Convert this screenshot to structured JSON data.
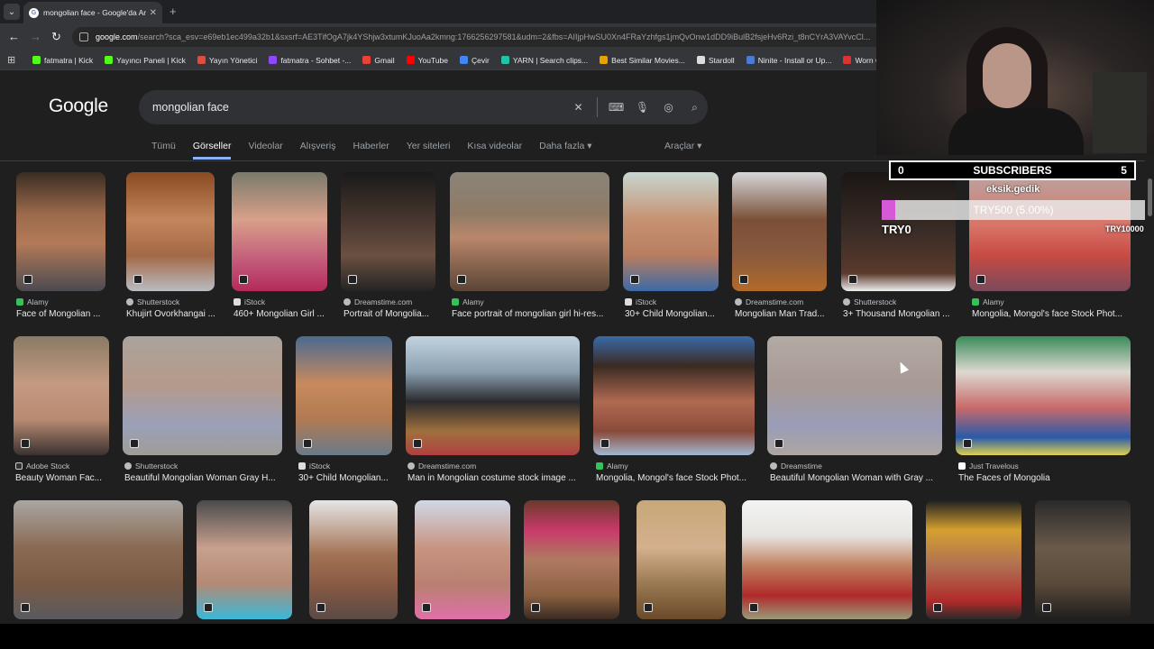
{
  "browser": {
    "tab_title": "mongolian face - Google'da Ara",
    "url_host": "google.com",
    "url_rest": "/search?sca_esv=e69eb1ec499a32b1&sxsrf=AE3TifOgA7jk4YShjw3xtumKJuoAa2kmng:1766256297581&udm=2&fbs=AIIjpHwSU0Xn4FRaYzhfgs1jmQvOnw1dDD9iBulB2fsjeHv6Rzi_t8nCYrA3VAYvcCl...",
    "bookmarks": [
      {
        "label": "fatmatra | Kick",
        "color": "#53fc18"
      },
      {
        "label": "Yayıncı Paneli | Kick",
        "color": "#53fc18"
      },
      {
        "label": "Yayın Yönetici",
        "color": "#e34b3a"
      },
      {
        "label": "fatmatra - Sohbet -...",
        "color": "#9146ff"
      },
      {
        "label": "Gmail",
        "color": "#ea4335"
      },
      {
        "label": "YouTube",
        "color": "#ff0000"
      },
      {
        "label": "Çevir",
        "color": "#4285f4"
      },
      {
        "label": "YARN | Search clips...",
        "color": "#22c3a6"
      },
      {
        "label": "Best Similar Movies...",
        "color": "#e8a100"
      },
      {
        "label": "Stardoll",
        "color": "#dddddd"
      },
      {
        "label": "Ninite - Install or Up...",
        "color": "#4a7bd6"
      },
      {
        "label": "Worn On TV | Wher",
        "color": "#d33"
      }
    ]
  },
  "google": {
    "logo": "Google",
    "query": "mongolian face",
    "tabs": [
      "Tümü",
      "Görseller",
      "Videolar",
      "Alışveriş",
      "Haberler",
      "Yer siteleri",
      "Kısa videolar",
      "Daha fazla ▾"
    ],
    "tools": "Araçlar ▾"
  },
  "results_row1": [
    {
      "source": "Alamy",
      "title": "Face of Mongolian ..."
    },
    {
      "source": "Shutterstock",
      "title": "Khujirt Ovorkhangai ..."
    },
    {
      "source": "iStock",
      "title": "460+ Mongolian Girl ..."
    },
    {
      "source": "Dreamstime.com",
      "title": "Portrait of Mongolia..."
    },
    {
      "source": "Alamy",
      "title": "Face portrait of mongolian girl hi-res..."
    },
    {
      "source": "iStock",
      "title": "30+ Child Mongolian..."
    },
    {
      "source": "Dreamstime.com",
      "title": "Mongolian Man Trad..."
    },
    {
      "source": "Shutterstock",
      "title": "3+ Thousand Mongolian ..."
    },
    {
      "source": "Alamy",
      "title": "Mongolia, Mongol's face Stock Phot..."
    }
  ],
  "results_row2": [
    {
      "source": "Adobe Stock",
      "title": "Beauty Woman Fac..."
    },
    {
      "source": "Shutterstock",
      "title": "Beautiful Mongolian Woman Gray H..."
    },
    {
      "source": "iStock",
      "title": "30+ Child Mongolian..."
    },
    {
      "source": "Dreamstime.com",
      "title": "Man in Mongolian costume stock image ..."
    },
    {
      "source": "Alamy",
      "title": "Mongolia, Mongol's face Stock Phot..."
    },
    {
      "source": "Dreamstime",
      "title": "Beautiful Mongolian Woman with Gray ..."
    },
    {
      "source": "Just Travelous",
      "title": "The Faces of Mongolia"
    }
  ],
  "stream_overlay": {
    "subs_left": "0",
    "subs_label": "SUBSCRIBERS",
    "subs_right": "5",
    "donor": "eksik.gedik",
    "goal_text": "TRY500 (5.00%)",
    "goal_progress": 0.05,
    "goal_min": "TRY0",
    "goal_max": "TRY10000"
  }
}
